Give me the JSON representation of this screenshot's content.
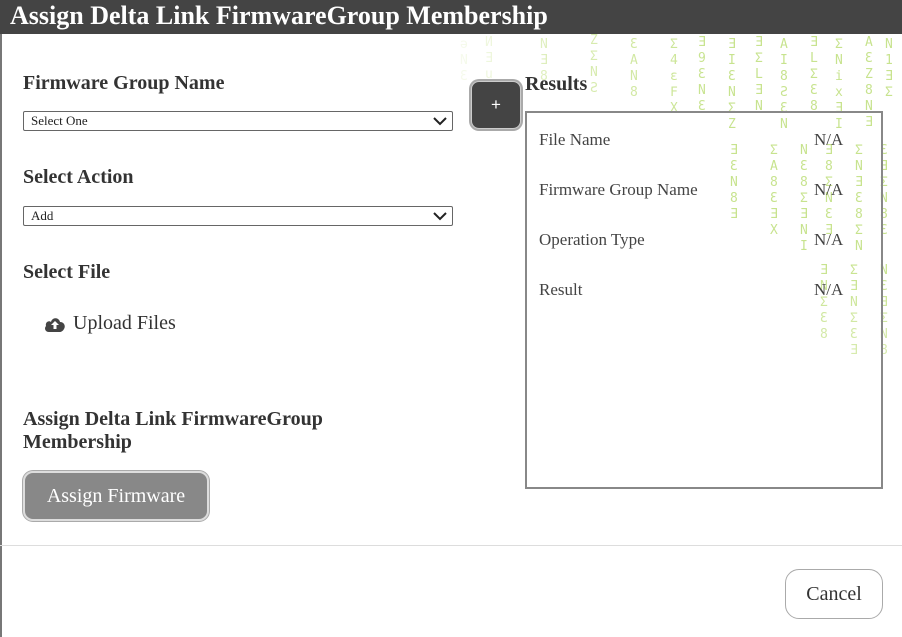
{
  "dialog": {
    "title": "Assign Delta Link FirmwareGroup Membership"
  },
  "form": {
    "firmware_group_label": "Firmware Group Name",
    "firmware_group_value": "Select One",
    "action_label": "Select Action",
    "action_value": "Add",
    "file_label": "Select File",
    "upload_label": "Upload Files",
    "assign_section_label": "Assign Delta Link FirmwareGroup Membership",
    "assign_button_label": "Assign Firmware",
    "add_button_label": "+"
  },
  "results": {
    "title": "Results",
    "rows": [
      {
        "key": "File Name",
        "value": "N/A"
      },
      {
        "key": "Firmware Group Name",
        "value": "N/A"
      },
      {
        "key": "Operation Type",
        "value": "N/A"
      },
      {
        "key": "Result",
        "value": "N/A"
      }
    ]
  },
  "footer": {
    "cancel_label": "Cancel"
  },
  "colors": {
    "titlebar": "#444444",
    "rain": "#9acd32",
    "button_gray": "#888888"
  },
  "icons": [
    "cloud-upload-icon",
    "chevron-down-icon",
    "plus-icon"
  ]
}
